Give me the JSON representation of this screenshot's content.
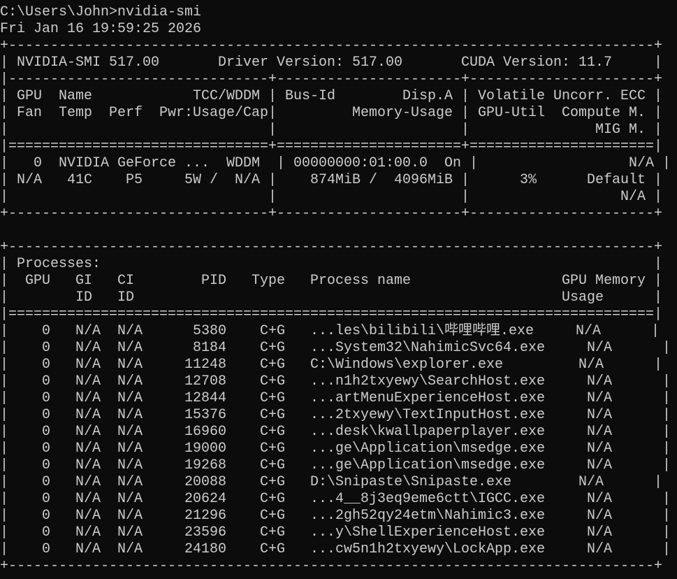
{
  "terminal": {
    "prompt": "C:\\Users\\John>",
    "command": "nvidia-smi",
    "timestamp": "Fri Jan 16 19:59:25 2026",
    "text_color": "#cccccc",
    "background": "#0c0c0c",
    "lines": [
      "+-----------------------------------------------------------------------------+",
      "| NVIDIA-SMI 517.00       Driver Version: 517.00       CUDA Version: 11.7     |",
      "|-------------------------------+----------------------+----------------------+",
      "| GPU  Name            TCC/WDDM | Bus-Id        Disp.A | Volatile Uncorr. ECC |",
      "| Fan  Temp  Perf  Pwr:Usage/Cap|         Memory-Usage | GPU-Util  Compute M. |",
      "|                               |                      |               MIG M. |",
      "|===============================+======================+======================|",
      "|   0  NVIDIA GeForce ...  WDDM  | 00000000:01:00.0  On |                  N/A |",
      "| N/A   41C    P5     5W /  N/A |    874MiB /  4096MiB |      3%      Default |",
      "|                               |                      |                  N/A |",
      "+-------------------------------+----------------------+----------------------+",
      "",
      "+-----------------------------------------------------------------------------+",
      "| Processes:                                                                  |",
      "|  GPU   GI   CI        PID   Type   Process name                  GPU Memory |",
      "|        ID   ID                                                   Usage      |",
      "|=============================================================================|",
      "|    0   N/A  N/A      5380    C+G   ...les\\bilibili\\哔哩哔哩.exe     N/A      |",
      "|    0   N/A  N/A      8184    C+G   ...System32\\NahimicSvc64.exe     N/A      |",
      "|    0   N/A  N/A     11248    C+G   C:\\Windows\\explorer.exe         N/A      |",
      "|    0   N/A  N/A     12708    C+G   ...n1h2txyewy\\SearchHost.exe     N/A      |",
      "|    0   N/A  N/A     12844    C+G   ...artMenuExperienceHost.exe     N/A      |",
      "|    0   N/A  N/A     15376    C+G   ...2txyewy\\TextInputHost.exe     N/A      |",
      "|    0   N/A  N/A     16960    C+G   ...desk\\kwallpaperplayer.exe     N/A      |",
      "|    0   N/A  N/A     19000    C+G   ...ge\\Application\\msedge.exe     N/A      |",
      "|    0   N/A  N/A     19268    C+G   ...ge\\Application\\msedge.exe     N/A      |",
      "|    0   N/A  N/A     20088    C+G   D:\\Snipaste\\Snipaste.exe        N/A      |",
      "|    0   N/A  N/A     20624    C+G   ...4__8j3eq9eme6ctt\\IGCC.exe     N/A      |",
      "|    0   N/A  N/A     21296    C+G   ...2gh52qy24etm\\Nahimic3.exe     N/A      |",
      "|    0   N/A  N/A     23596    C+G   ...y\\ShellExperienceHost.exe     N/A      |",
      "|    0   N/A  N/A     24180    C+G   ...cw5n1h2txyewy\\LockApp.exe     N/A      |",
      "+-----------------------------------------------------------------------------+"
    ]
  }
}
